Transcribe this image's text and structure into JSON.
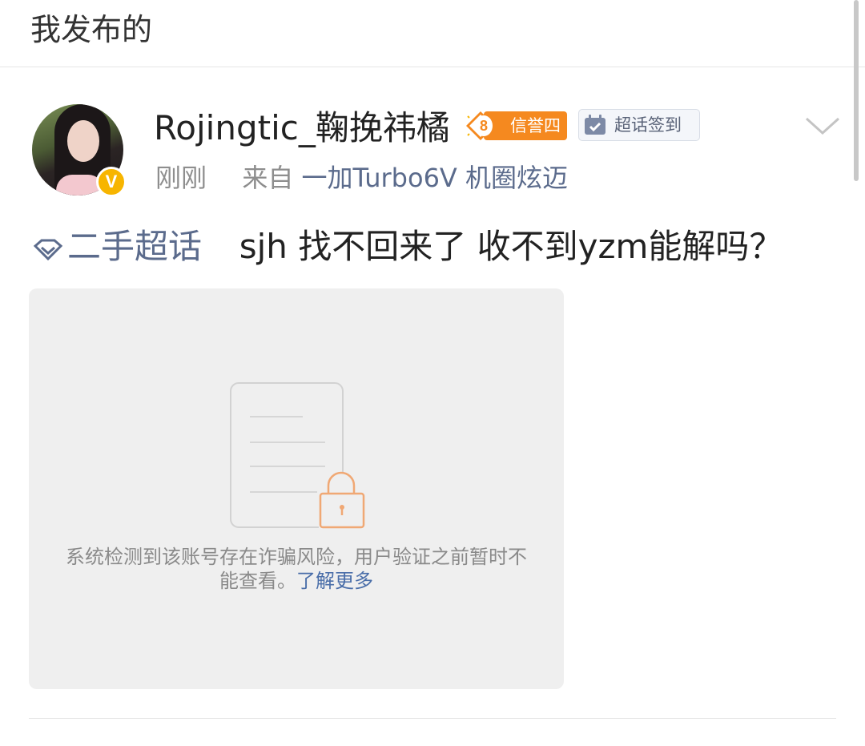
{
  "header": {
    "title": "我发布的"
  },
  "post": {
    "author": {
      "name": "Rojingtic_鞠挽祎橘",
      "verified_badge": "V",
      "credit_level": "8",
      "credit_label": "信誉四",
      "checkin_label": "超话签到"
    },
    "meta": {
      "time": "刚刚",
      "source_prefix": "来自",
      "source": "一加Turbo6V 机圈炫迈"
    },
    "topic": "二手超话",
    "text": "sjh 找不回来了 收不到yzm能解吗？",
    "blocked_notice": {
      "message": "系统检测到该账号存在诈骗风险，用户验证之前暂时不能查看。",
      "link": "了解更多"
    }
  },
  "icons": {
    "menu": "chevron-down-icon",
    "topic": "diamond-topic-icon",
    "checkin": "calendar-check-icon",
    "lock": "lock-icon"
  },
  "colors": {
    "link": "#5b6b8c",
    "credit_orange": "#f5891f",
    "verified_gold": "#f7b500"
  }
}
